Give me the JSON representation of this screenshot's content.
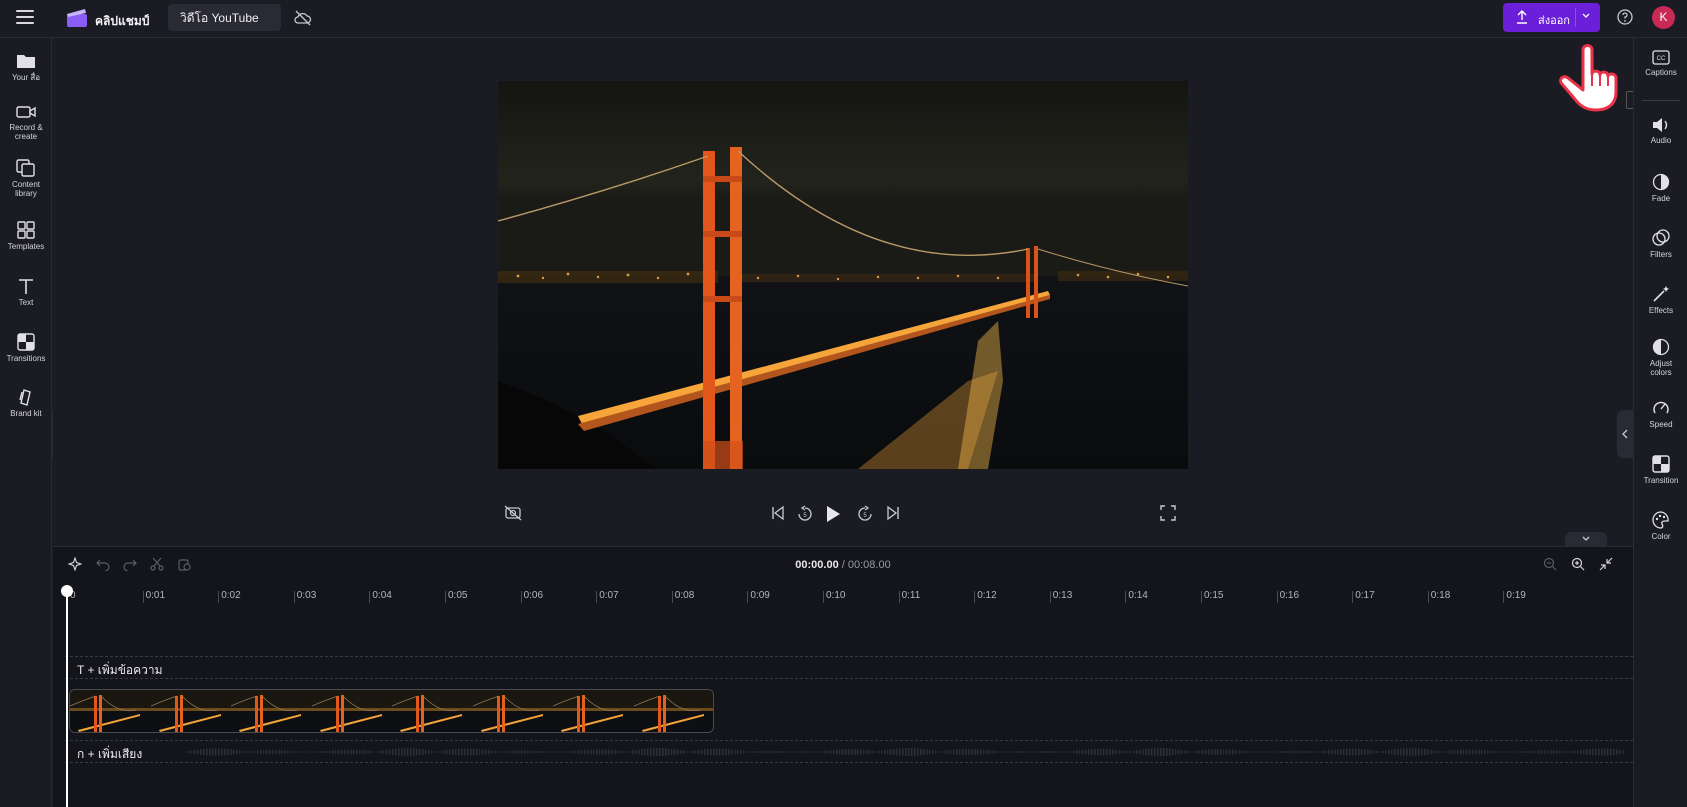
{
  "app": {
    "name": "คลิปแชมป์",
    "project_title": "วิดีโอ YouTube",
    "export_label": "ส่งออก",
    "avatar_initial": "K"
  },
  "left_nav": [
    {
      "label": "Your สื่อ",
      "icon": "folder-icon"
    },
    {
      "label": "Record &\ncreate",
      "icon": "camera-icon"
    },
    {
      "label": "Content\nlibrary",
      "icon": "library-icon"
    },
    {
      "label": "Templates",
      "icon": "templates-icon"
    },
    {
      "label": "Text",
      "icon": "text-icon"
    },
    {
      "label": "Transitions",
      "icon": "transitions-icon"
    },
    {
      "label": "Brand kit",
      "icon": "brand-kit-icon"
    }
  ],
  "right_nav": [
    {
      "label": "Captions",
      "icon": "captions-icon"
    },
    {
      "label": "Audio",
      "icon": "audio-icon"
    },
    {
      "label": "Fade",
      "icon": "fade-icon"
    },
    {
      "label": "Filters",
      "icon": "filters-icon"
    },
    {
      "label": "Effects",
      "icon": "effects-icon"
    },
    {
      "label": "Adjust\ncolors",
      "icon": "adjust-colors-icon"
    },
    {
      "label": "Speed",
      "icon": "speed-icon"
    },
    {
      "label": "Transition",
      "icon": "transition-icon"
    },
    {
      "label": "Color",
      "icon": "color-icon"
    }
  ],
  "timeline": {
    "current_time": "00:00.00",
    "separator": " / ",
    "total_time": "00:08.00",
    "ruler_labels": [
      "0",
      "0:01",
      "0:02",
      "0:03",
      "0:04",
      "0:05",
      "0:06",
      "0:07",
      "0:08",
      "0:09",
      "0:10",
      "0:11",
      "0:12",
      "0:13",
      "0:14",
      "0:15",
      "0:16",
      "0:17",
      "0:18",
      "0:19"
    ],
    "add_text_label": "T + เพิ่มข้อความ",
    "add_audio_label": "ก + เพิ่มเสียง"
  },
  "colors": {
    "accent": "#6c1fd9",
    "avatar": "#c72a54",
    "background": "#1b1b23"
  }
}
